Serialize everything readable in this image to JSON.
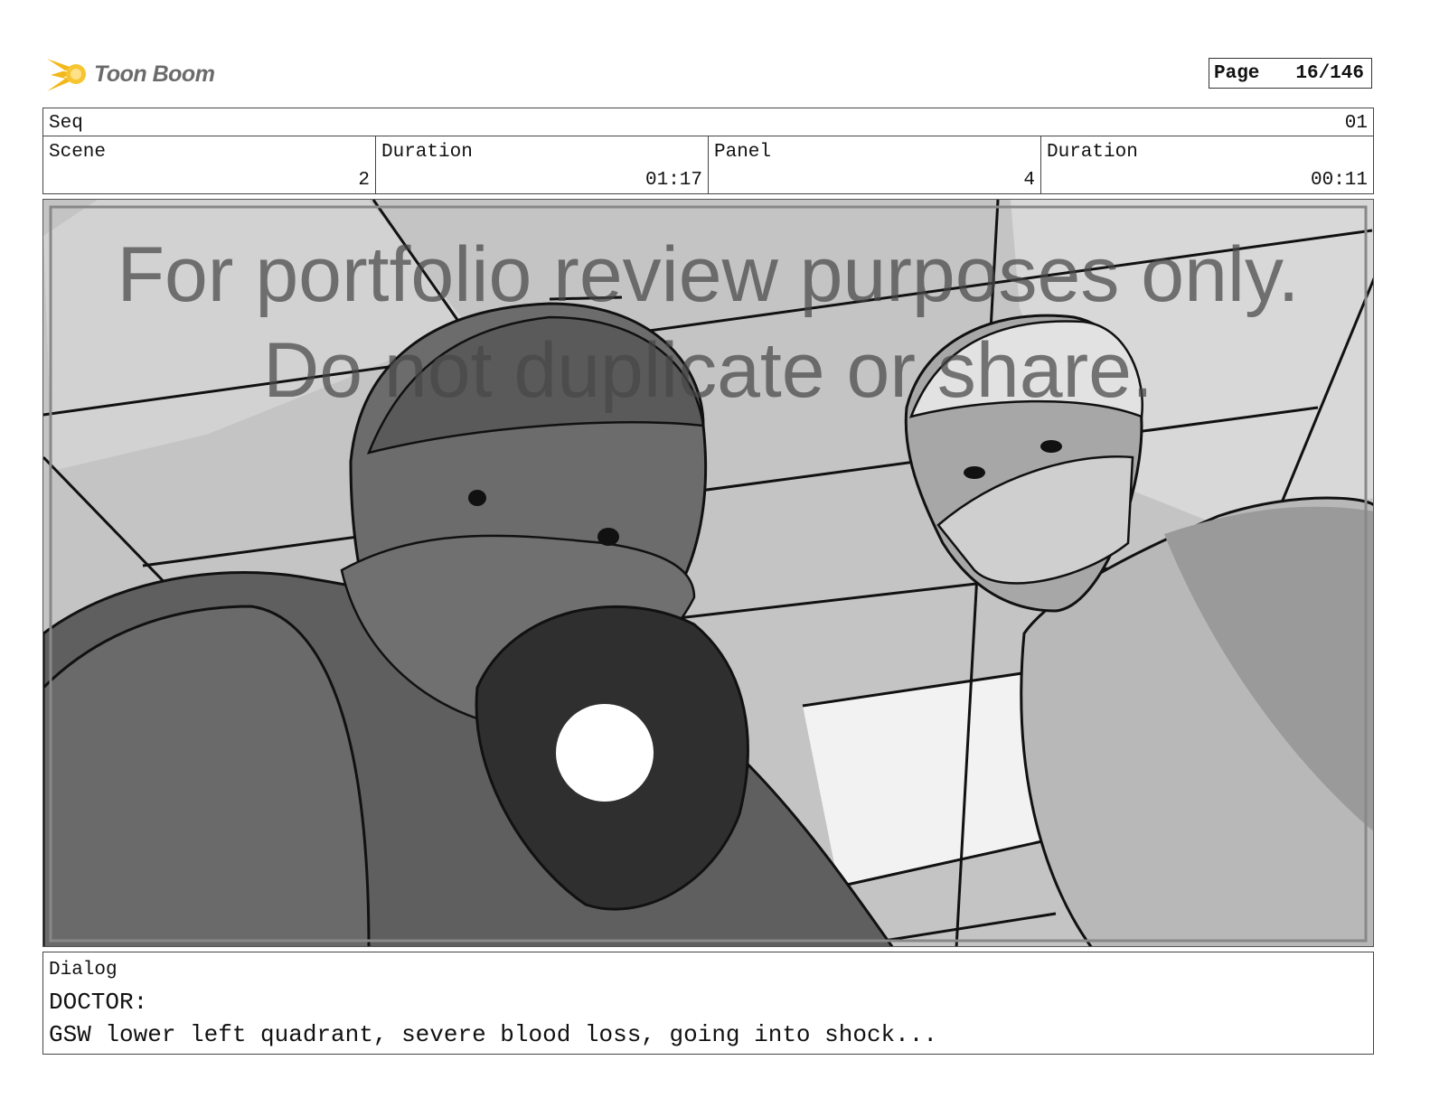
{
  "header": {
    "logo_text": "Toon Boom",
    "page_label": "Page",
    "page_value": "16/146"
  },
  "seq": {
    "label": "Seq",
    "value": "01"
  },
  "info": [
    {
      "label": "Scene",
      "value": "2"
    },
    {
      "label": "Duration",
      "value": "01:17"
    },
    {
      "label": "Panel",
      "value": "4"
    },
    {
      "label": "Duration",
      "value": "00:11"
    }
  ],
  "panel": {
    "watermark_line1": "For portfolio review purposes only.",
    "watermark_line2": "Do not duplicate or share."
  },
  "dialog": {
    "label": "Dialog",
    "speaker": "DOCTOR:",
    "text": "GSW lower left quadrant, severe blood loss, going into shock..."
  },
  "colors": {
    "logo_accent": "#f2b81b",
    "logo_text": "#6b6b6b"
  }
}
